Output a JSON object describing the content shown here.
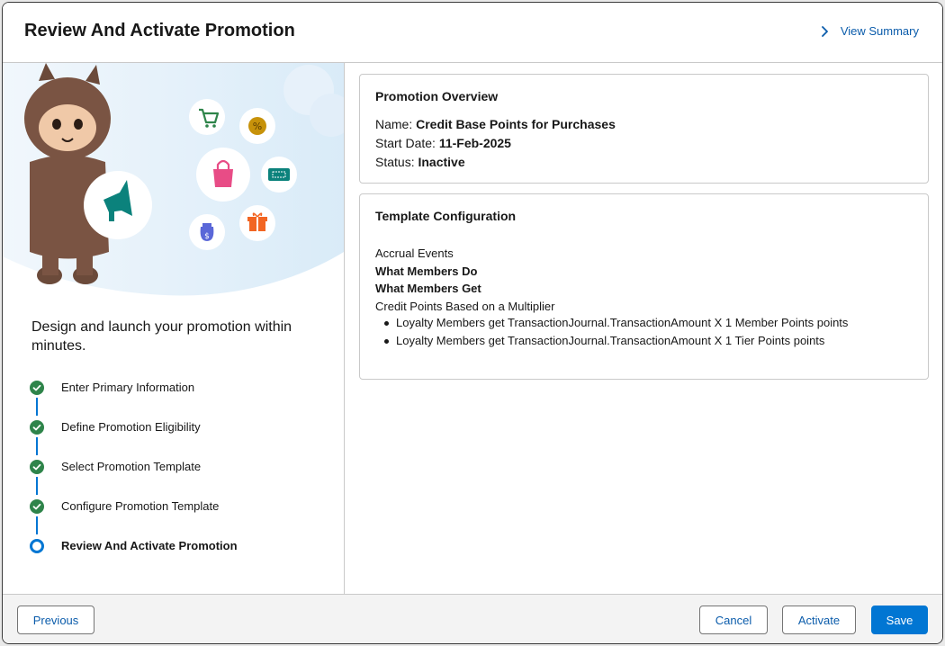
{
  "header": {
    "title": "Review And Activate Promotion",
    "view_summary_label": "View Summary"
  },
  "left_panel": {
    "tagline": "Design and launch your promotion within minutes.",
    "steps": [
      {
        "label": "Enter Primary Information",
        "status": "complete"
      },
      {
        "label": "Define Promotion Eligibility",
        "status": "complete"
      },
      {
        "label": "Select Promotion Template",
        "status": "complete"
      },
      {
        "label": "Configure Promotion Template",
        "status": "complete"
      },
      {
        "label": "Review And Activate Promotion",
        "status": "current"
      }
    ]
  },
  "overview": {
    "title": "Promotion Overview",
    "name_label": "Name:",
    "name_value": "Credit Base Points for Purchases",
    "start_label": "Start Date:",
    "start_value": "11-Feb-2025",
    "status_label": "Status:",
    "status_value": "Inactive"
  },
  "template_config": {
    "title": "Template Configuration",
    "accrual_events": "Accrual Events",
    "what_members_do": "What Members Do",
    "what_members_get": "What Members Get",
    "credit_points": "Credit Points Based on a Multiplier",
    "bullets": [
      "Loyalty Members get TransactionJournal.TransactionAmount X 1 Member Points points",
      "Loyalty Members get TransactionJournal.TransactionAmount X 1 Tier Points points"
    ]
  },
  "footer": {
    "previous_label": "Previous",
    "cancel_label": "Cancel",
    "activate_label": "Activate",
    "save_label": "Save"
  },
  "colors": {
    "brand": "#0176d3",
    "link": "#0b5cab",
    "success": "#2e844a",
    "border": "#c9c9c9"
  },
  "icons": [
    "chevron-right-icon",
    "shopping-cart-icon",
    "percent-badge-icon",
    "shopping-bag-icon",
    "ticket-icon",
    "megaphone-icon",
    "money-bag-icon",
    "gift-icon",
    "check-circle-icon",
    "current-step-icon"
  ]
}
